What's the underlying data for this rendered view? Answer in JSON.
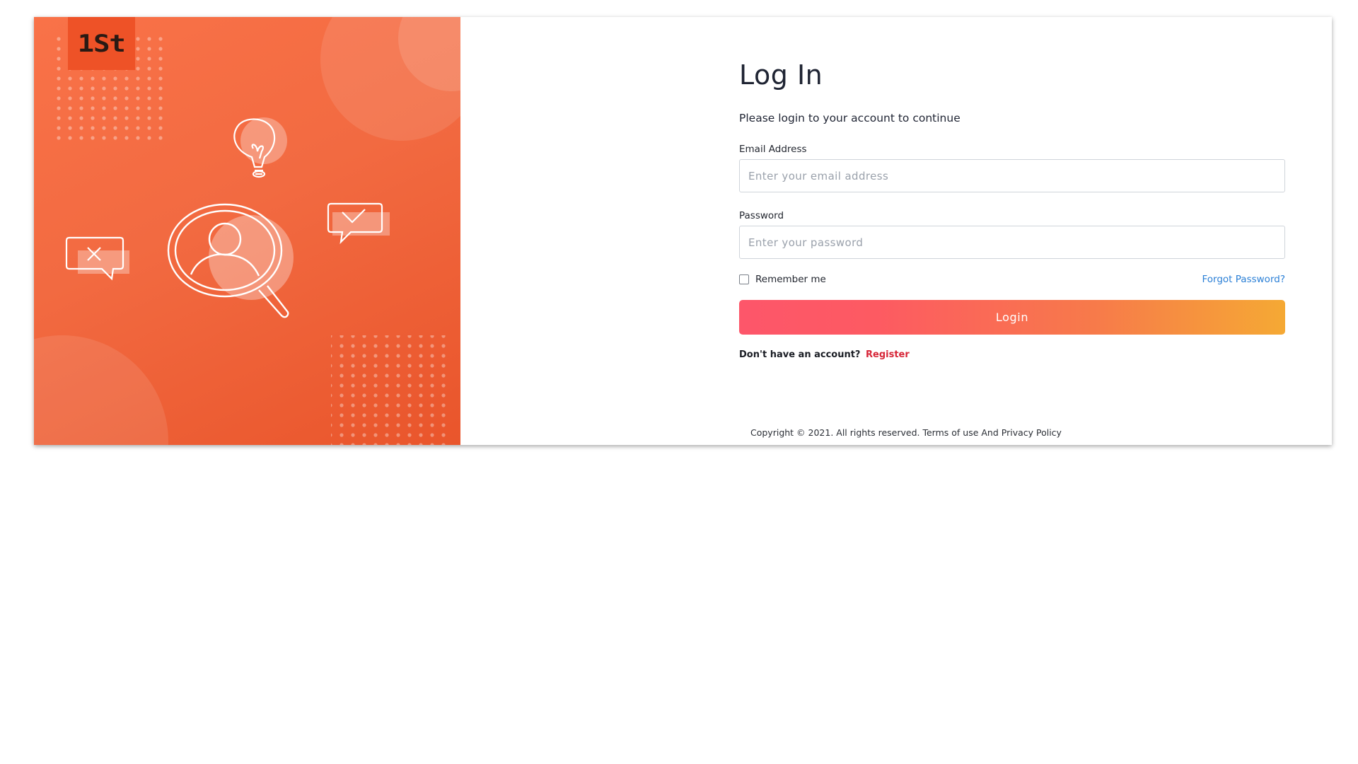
{
  "brand": {
    "logo_text": "1St",
    "colors": {
      "hero_start": "#f97248",
      "hero_end": "#e9552b",
      "button_start": "#fd566a",
      "button_end": "#f5a934",
      "link": "#2a7fd6",
      "register_link": "#d72638"
    }
  },
  "hero": {
    "illustration_icons": [
      "lightbulb-icon",
      "user-search-icon",
      "chat-check-icon",
      "chat-close-icon"
    ]
  },
  "login": {
    "title": "Log In",
    "subtitle": "Please login to your account to continue",
    "email_label": "Email Address",
    "email_placeholder": "Enter your email address",
    "email_value": "",
    "password_label": "Password",
    "password_placeholder": "Enter your password",
    "password_value": "",
    "remember_label": "Remember me",
    "remember_checked": false,
    "forgot_label": "Forgot Password?",
    "button_label": "Login",
    "no_account_text": "Don't have an account?",
    "register_label": "Register"
  },
  "footer": {
    "copyright": "Copyright © 2021. All rights reserved. Terms of use And Privacy Policy"
  }
}
